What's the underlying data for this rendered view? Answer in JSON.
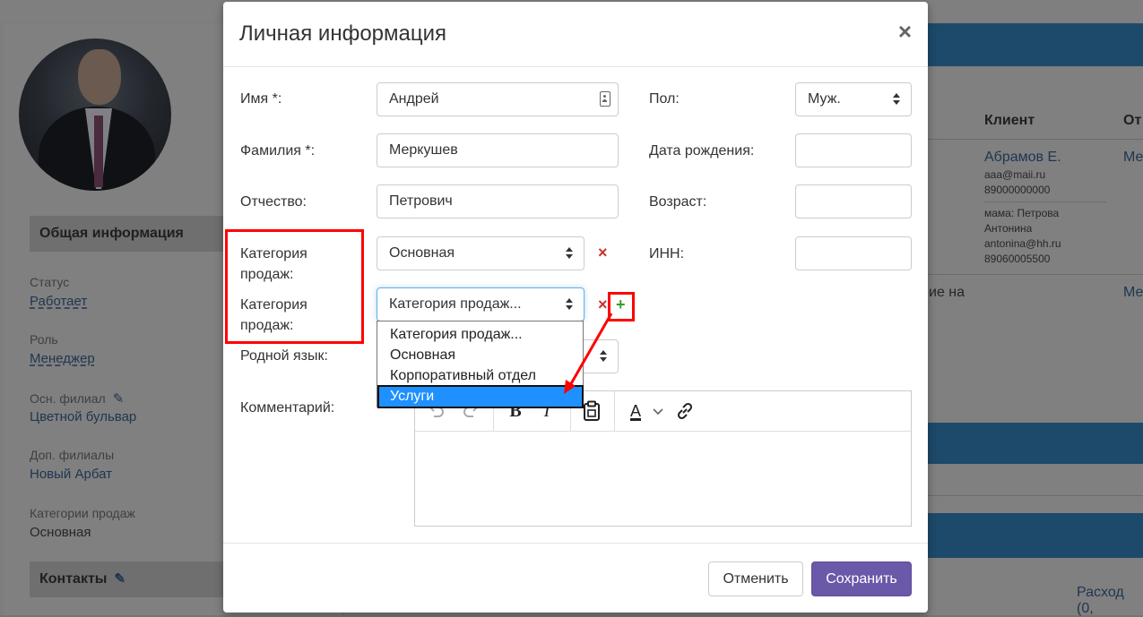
{
  "background": {
    "left_panel": {
      "section_general": "Общая информация",
      "fields": [
        {
          "label": "Статус",
          "value": "Работает"
        },
        {
          "label": "Роль",
          "value": "Менеджер"
        },
        {
          "label": "Осн. филиал",
          "value": "Цветной бульвар"
        },
        {
          "label": "Доп. филиалы",
          "value": "Новый Арбат"
        },
        {
          "label": "Категории продаж",
          "value": "Основная"
        }
      ],
      "section_contacts": "Контакты"
    },
    "right_panel": {
      "column_client": "Клиент",
      "column_other": "От",
      "client_name": "Абрамов Е.",
      "client_email": "aaa@maii.ru",
      "client_phone": "89000000000",
      "relative_line1": "мама: Петрова",
      "relative_line2": "Антонина",
      "relative_email": "antonina@hh.ru",
      "relative_phone": "89060005500",
      "row_link_1": "Ме",
      "row_link_2": "Ме",
      "partial_text": "ие на",
      "expense_text": "Расход (0,"
    }
  },
  "modal": {
    "title": "Личная информация",
    "close_symbol": "×",
    "form": {
      "first_name": {
        "label": "Имя *:",
        "value": "Андрей"
      },
      "last_name": {
        "label": "Фамилия *:",
        "value": "Меркушев"
      },
      "patronymic": {
        "label": "Отчество:",
        "value": "Петрович"
      },
      "sales_category_1": {
        "label": "Категория продаж:",
        "value": "Основная"
      },
      "sales_category_2": {
        "label": "Категория продаж:",
        "value": "Категория продаж..."
      },
      "native_language": {
        "label": "Родной язык:"
      },
      "comment": {
        "label": "Комментарий:"
      },
      "gender": {
        "label": "Пол:",
        "value": "Муж."
      },
      "birth_date": {
        "label": "Дата рождения:",
        "value": ""
      },
      "age": {
        "label": "Возраст:",
        "value": ""
      },
      "inn": {
        "label": "ИНН:",
        "value": ""
      },
      "remove_symbol": "×",
      "add_symbol": "+"
    },
    "dropdown_options": [
      "Категория продаж...",
      "Основная",
      "Корпоративный отдел",
      "Услуги"
    ],
    "dropdown_selected": "Услуги",
    "editor_toolbar": {
      "bold": "B",
      "italic": "I",
      "font_color": "A"
    },
    "buttons": {
      "cancel": "Отменить",
      "save": "Сохранить"
    }
  },
  "colors": {
    "accent_purple": "#6a58a8",
    "highlight_red": "#ff0000",
    "option_selected": "#1e90ff",
    "remove_red": "#c9302c",
    "add_green": "#3c9b2d"
  }
}
